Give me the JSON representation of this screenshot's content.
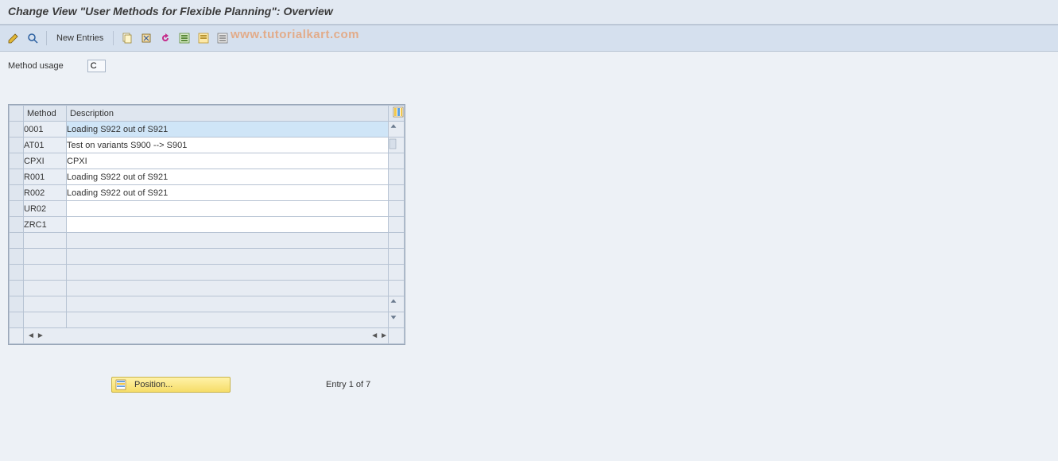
{
  "title": "Change View \"User Methods for Flexible Planning\": Overview",
  "toolbar": {
    "new_entries_label": "New Entries"
  },
  "watermark": "www.tutorialkart.com",
  "method_usage": {
    "label": "Method usage",
    "value": "C"
  },
  "table": {
    "headers": {
      "method": "Method",
      "description": "Description"
    },
    "rows": [
      {
        "method": "0001",
        "description": "Loading S922 out of S921",
        "selected": true
      },
      {
        "method": "AT01",
        "description": "Test on variants S900 --> S901"
      },
      {
        "method": "CPXI",
        "description": "CPXI"
      },
      {
        "method": "R001",
        "description": "Loading S922 out of S921"
      },
      {
        "method": "R002",
        "description": "Loading S922 out of S921"
      },
      {
        "method": "UR02",
        "description": ""
      },
      {
        "method": "ZRC1",
        "description": ""
      }
    ],
    "blank_rows": 6
  },
  "footer": {
    "position_label": "Position...",
    "entry_info": "Entry 1 of 7"
  }
}
